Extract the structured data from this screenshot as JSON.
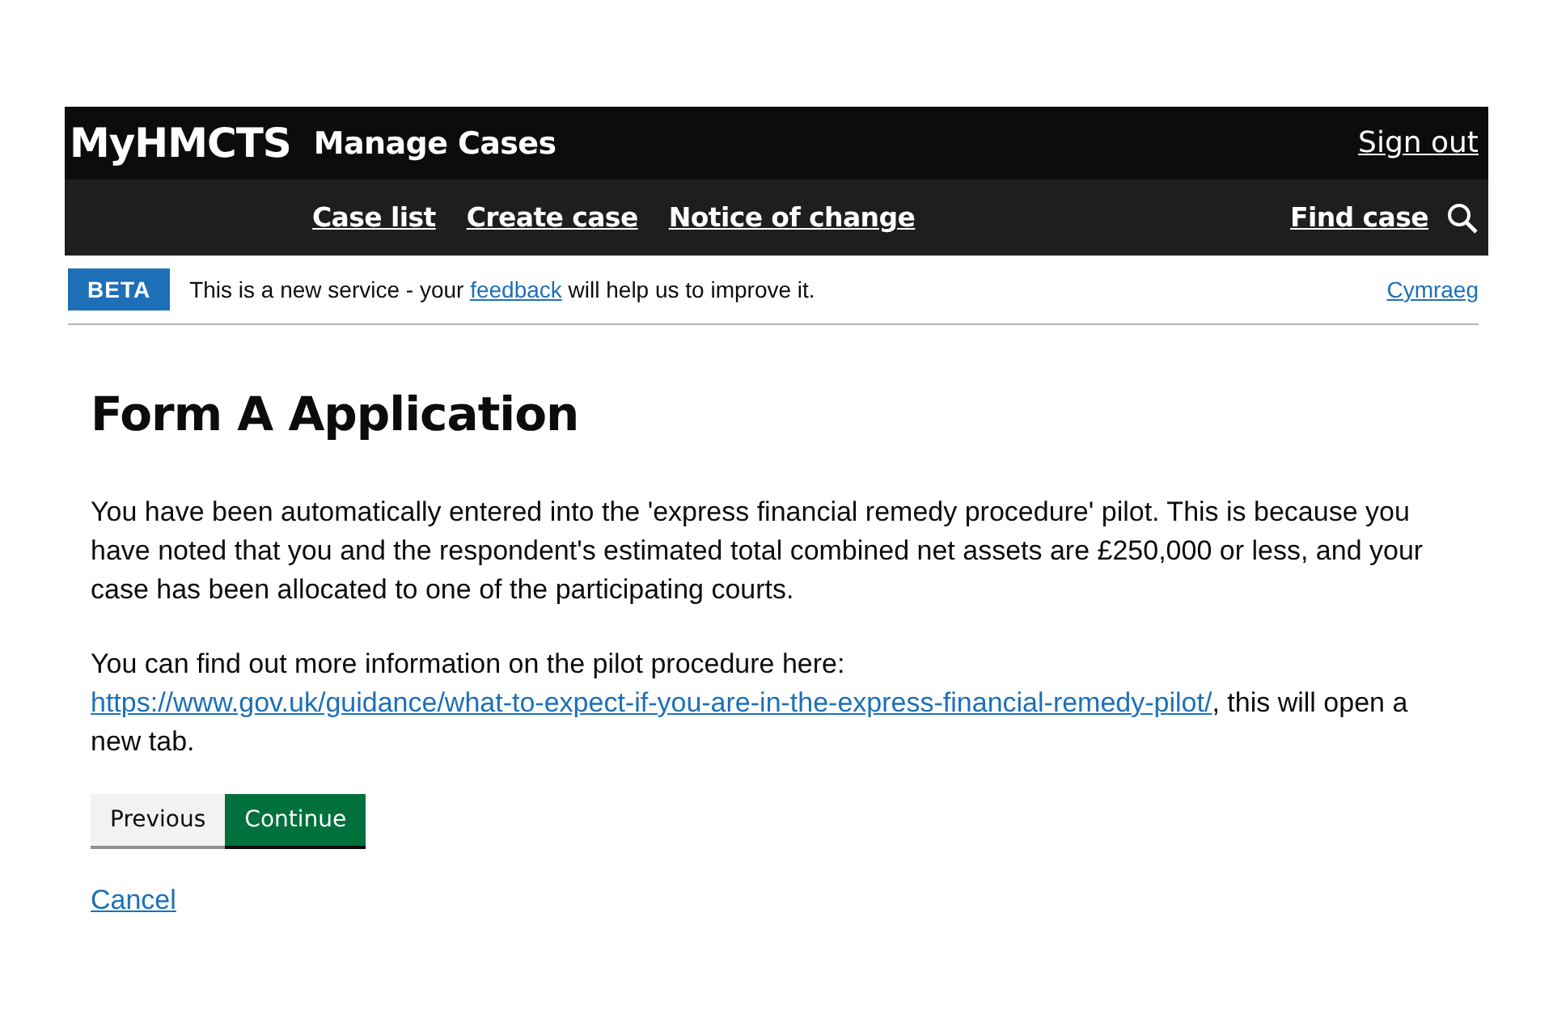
{
  "header": {
    "logo": "MyHMCTS",
    "service": "Manage Cases",
    "sign_out": "Sign out"
  },
  "nav": {
    "items": [
      {
        "label": "Case list"
      },
      {
        "label": "Create case"
      },
      {
        "label": "Notice of change"
      }
    ],
    "find": "Find case"
  },
  "phase_banner": {
    "tag": "BETA",
    "before": "This is a new service - your",
    "link": "feedback",
    "after": "will help us to improve it.",
    "language": "Cymraeg"
  },
  "title": "Form A Application",
  "paragraphs": [
    {
      "before": "You have been automatically entered into the 'express financial remedy procedure' pilot. This is because you have noted that you and the respondent's estimated total combined net assets are £250,000 or less, and your case has been allocated to one of the participating courts."
    },
    {
      "before": "You can find out more information on the pilot procedure here:",
      "link": "https://www.gov.uk/guidance/what-to-expect-if-you-are-in-the-express-financial-remedy-pilot/",
      "after": ", this will open a new tab."
    }
  ],
  "buttons": [
    {
      "label": "Previous",
      "kind": "secondary"
    },
    {
      "label": "Continue",
      "kind": "primary"
    }
  ],
  "cancel": "Cancel"
}
